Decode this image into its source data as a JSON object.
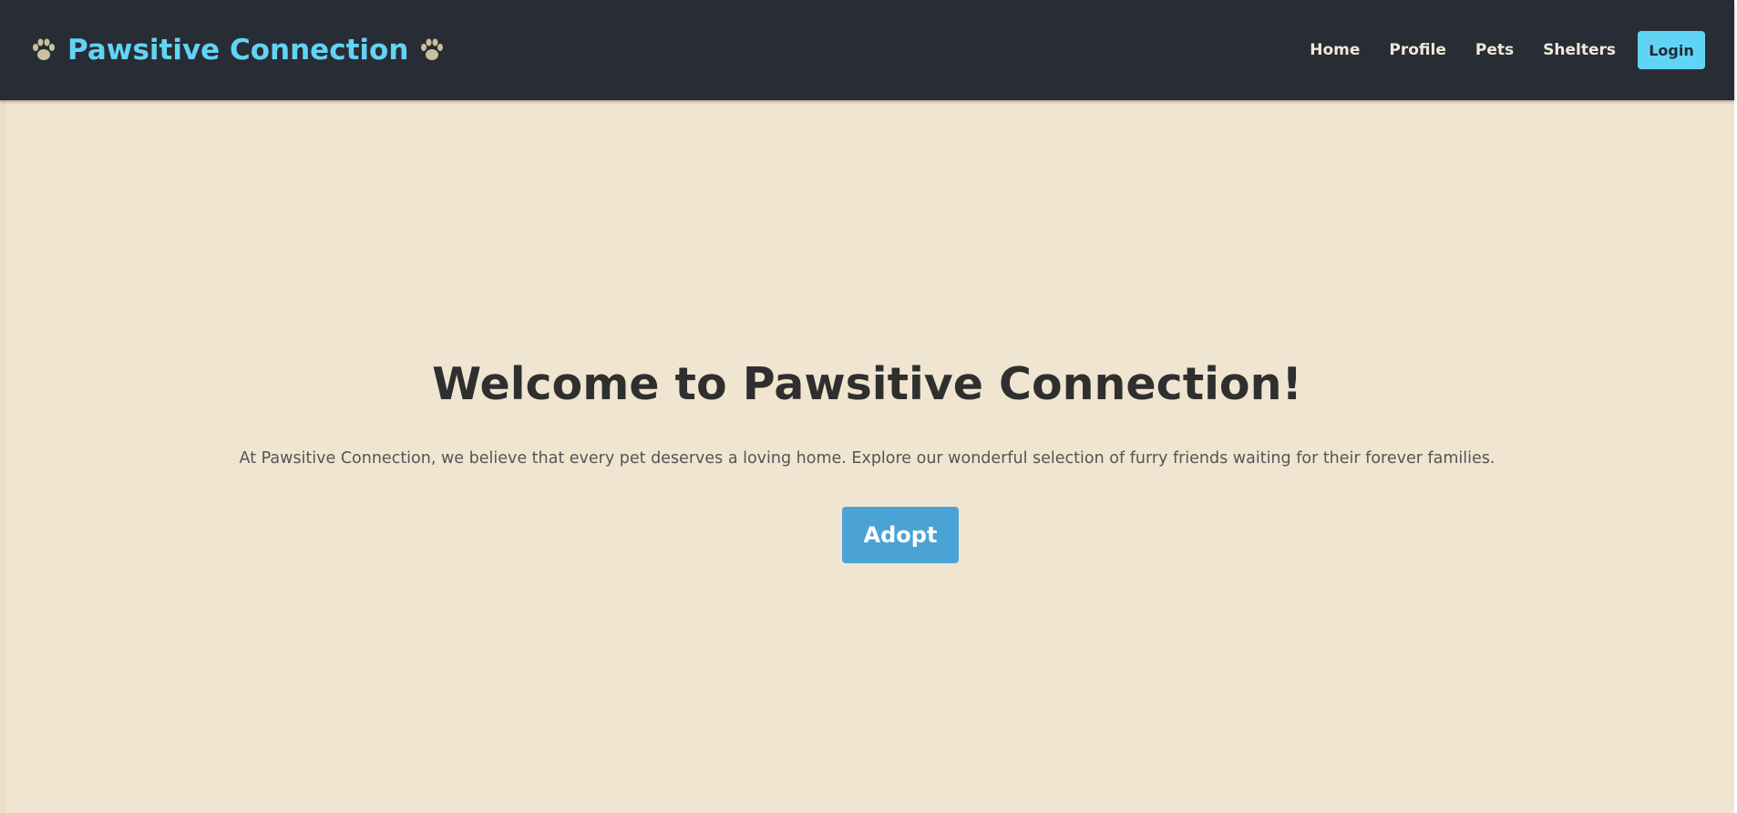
{
  "navbar": {
    "brand": "Pawsitive Connection",
    "links": [
      "Home",
      "Profile",
      "Pets",
      "Shelters"
    ],
    "login_label": "Login"
  },
  "hero": {
    "title": "Welcome to Pawsitive Connection!",
    "description": "At Pawsitive Connection, we believe that every pet deserves a loving home. Explore our wonderful selection of furry friends waiting for their forever families.",
    "cta_label": "Adopt"
  },
  "colors": {
    "navbar_bg": "#282c35",
    "brand_accent": "#61d4f5",
    "page_bg": "#f0e5d0",
    "cta_bg": "#4aa3d4",
    "paw_color": "#c8c19c"
  },
  "icons": {
    "brand_left": "paw-print-icon",
    "brand_right": "paw-print-icon"
  }
}
